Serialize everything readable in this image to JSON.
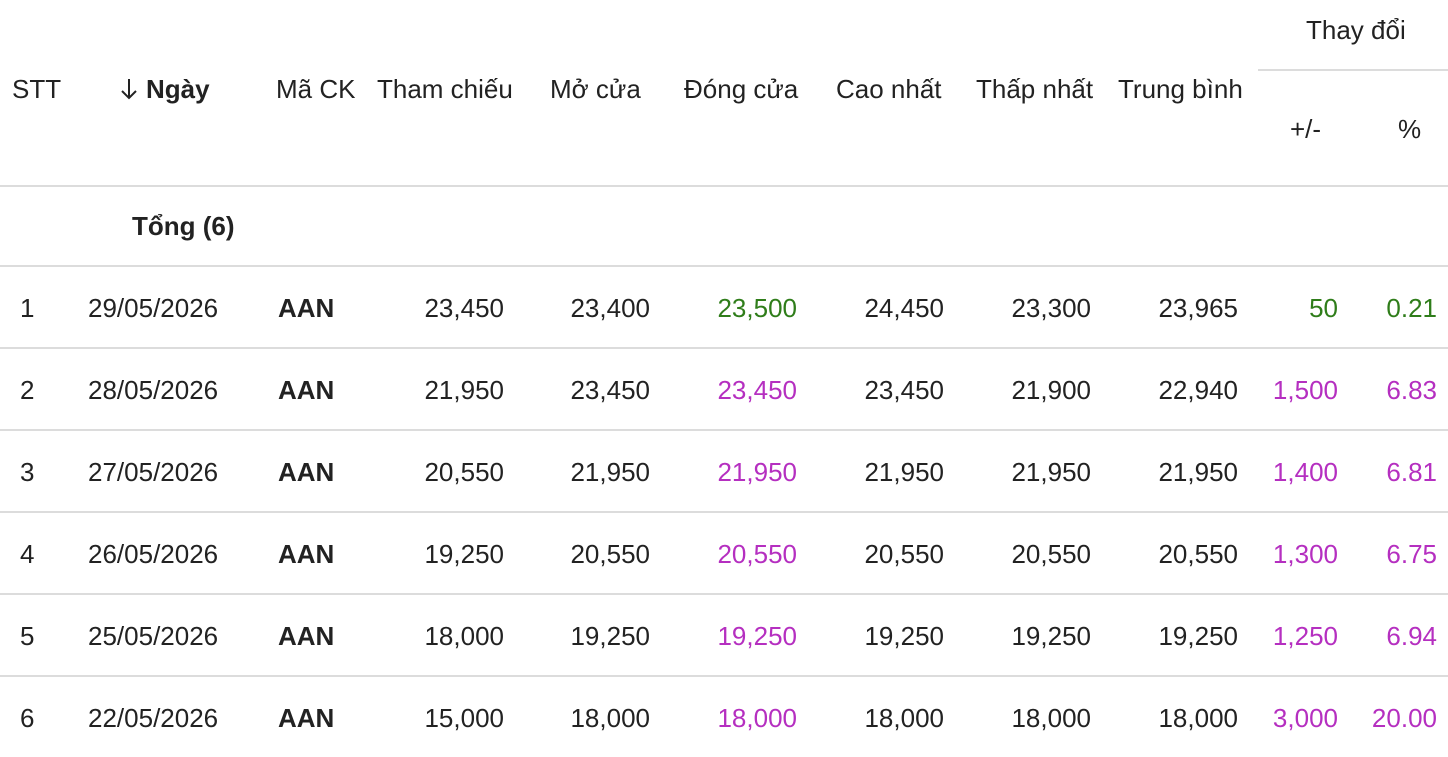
{
  "colors": {
    "up": "#2f7d1a",
    "ceiling": "#b52fc0",
    "text": "#222222",
    "divider": "#dcdcdc"
  },
  "header": {
    "stt": "STT",
    "date": "Ngày",
    "date_sort_icon": "arrow-down-icon",
    "symbol": "Mã CK",
    "reference": "Tham chiếu",
    "open": "Mở cửa",
    "close": "Đóng cửa",
    "high": "Cao nhất",
    "low": "Thấp nhất",
    "average": "Trung bình",
    "change_group": "Thay đổi",
    "change_abs": "+/-",
    "change_pct": "%"
  },
  "summary": {
    "label": "Tổng (6)"
  },
  "rows": [
    {
      "stt": "1",
      "date": "29/05/2026",
      "symbol": "AAN",
      "reference": "23,450",
      "open": "23,400",
      "close": "23,500",
      "high": "24,450",
      "low": "23,300",
      "average": "23,965",
      "change": "50",
      "pct": "0.21",
      "status": "up"
    },
    {
      "stt": "2",
      "date": "28/05/2026",
      "symbol": "AAN",
      "reference": "21,950",
      "open": "23,450",
      "close": "23,450",
      "high": "23,450",
      "low": "21,900",
      "average": "22,940",
      "change": "1,500",
      "pct": "6.83",
      "status": "ceiling"
    },
    {
      "stt": "3",
      "date": "27/05/2026",
      "symbol": "AAN",
      "reference": "20,550",
      "open": "21,950",
      "close": "21,950",
      "high": "21,950",
      "low": "21,950",
      "average": "21,950",
      "change": "1,400",
      "pct": "6.81",
      "status": "ceiling"
    },
    {
      "stt": "4",
      "date": "26/05/2026",
      "symbol": "AAN",
      "reference": "19,250",
      "open": "20,550",
      "close": "20,550",
      "high": "20,550",
      "low": "20,550",
      "average": "20,550",
      "change": "1,300",
      "pct": "6.75",
      "status": "ceiling"
    },
    {
      "stt": "5",
      "date": "25/05/2026",
      "symbol": "AAN",
      "reference": "18,000",
      "open": "19,250",
      "close": "19,250",
      "high": "19,250",
      "low": "19,250",
      "average": "19,250",
      "change": "1,250",
      "pct": "6.94",
      "status": "ceiling"
    },
    {
      "stt": "6",
      "date": "22/05/2026",
      "symbol": "AAN",
      "reference": "15,000",
      "open": "18,000",
      "close": "18,000",
      "high": "18,000",
      "low": "18,000",
      "average": "18,000",
      "change": "3,000",
      "pct": "20.00",
      "status": "ceiling"
    }
  ]
}
